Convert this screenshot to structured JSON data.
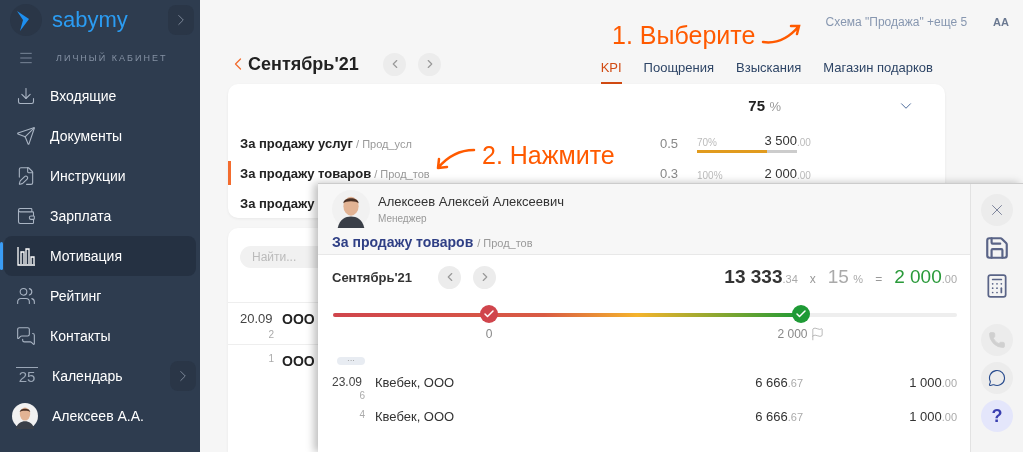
{
  "sidebar": {
    "logo": "sabymy",
    "section": "ЛИЧНЫЙ КАБИНЕТ",
    "items": [
      {
        "label": "Входящие",
        "selected": false
      },
      {
        "label": "Документы",
        "selected": false
      },
      {
        "label": "Инструкции",
        "selected": false
      },
      {
        "label": "Зарплата",
        "selected": false
      },
      {
        "label": "Мотивация",
        "selected": true
      },
      {
        "label": "Рейтинг",
        "selected": false
      },
      {
        "label": "Контакты",
        "selected": false
      },
      {
        "label": "Календарь",
        "selected": false,
        "day": "25"
      }
    ],
    "user": "Алексеев А.А."
  },
  "scheme_link": "Схема \"Продажа\" +еще 5",
  "font_button": "AA",
  "period": {
    "title": "Сентябрь'21"
  },
  "tabs": [
    {
      "label": "KPI",
      "selected": true
    },
    {
      "label": "Поощрения",
      "selected": false
    },
    {
      "label": "Взыскания",
      "selected": false
    },
    {
      "label": "Магазин подарков",
      "selected": false
    }
  ],
  "kpi_card": {
    "total": "75",
    "unit": "%",
    "rows": [
      {
        "name": "За продажу услуг",
        "code": "/ Прод_усл",
        "selected": false,
        "weight": "0.5",
        "percent": "70%",
        "level": 0.7,
        "amount": "3 500",
        "cents": ".00"
      },
      {
        "name": "За продажу товаров",
        "code": "/ Прод_тов",
        "selected": true,
        "weight": "0.3",
        "percent": "100%",
        "amount": "2 000",
        "cents": ".00"
      },
      {
        "name": "За продажу",
        "selected": false
      }
    ]
  },
  "list_card": {
    "search": {
      "placeholder": "Найти..."
    },
    "rows": [
      {
        "date": "20.09",
        "count": "2",
        "name": "ООО"
      },
      {
        "count": "1",
        "name": "ООО"
      }
    ]
  },
  "panel": {
    "person": {
      "name": "Алексеев Алексей Алексеевич",
      "role": "Менеджер"
    },
    "title": "За продажу товаров",
    "code": "/ Прод_тов",
    "period": "Сентябрь'21",
    "base": "13 333",
    "base_cents": ".34",
    "times": "x",
    "rate": "15",
    "rate_unit": "%",
    "equals": "=",
    "result": "2 000",
    "result_cents": ".00",
    "progress": {
      "level": 0.75,
      "milestones": [
        {
          "label": "0",
          "color": "#d0454c"
        },
        {
          "label": "2 000",
          "color": "#1e9a35",
          "kind": "goal"
        }
      ]
    },
    "more": "···",
    "rows": [
      {
        "date": "23.09",
        "count": "6",
        "name": "Квебек, ООО",
        "amount": "6 666",
        "amount_cents": ".67",
        "bonus": "1 000",
        "bonus_cents": ".00"
      },
      {
        "count": "4",
        "name": "Квебек, ООО",
        "amount": "6 666",
        "amount_cents": ".67",
        "bonus": "1 000",
        "bonus_cents": ".00"
      }
    ],
    "tools": [
      {
        "kind": "close",
        "disabled": false
      },
      {
        "kind": "save",
        "disabled": false
      },
      {
        "kind": "calculator",
        "disabled": false
      },
      {
        "kind": "phone",
        "disabled": true
      },
      {
        "kind": "chat",
        "disabled": false
      },
      {
        "kind": "help",
        "label": "?",
        "disabled": false
      }
    ]
  },
  "annotations": [
    {
      "text": "1. Выберите"
    },
    {
      "text": "2. Нажмите"
    }
  ]
}
